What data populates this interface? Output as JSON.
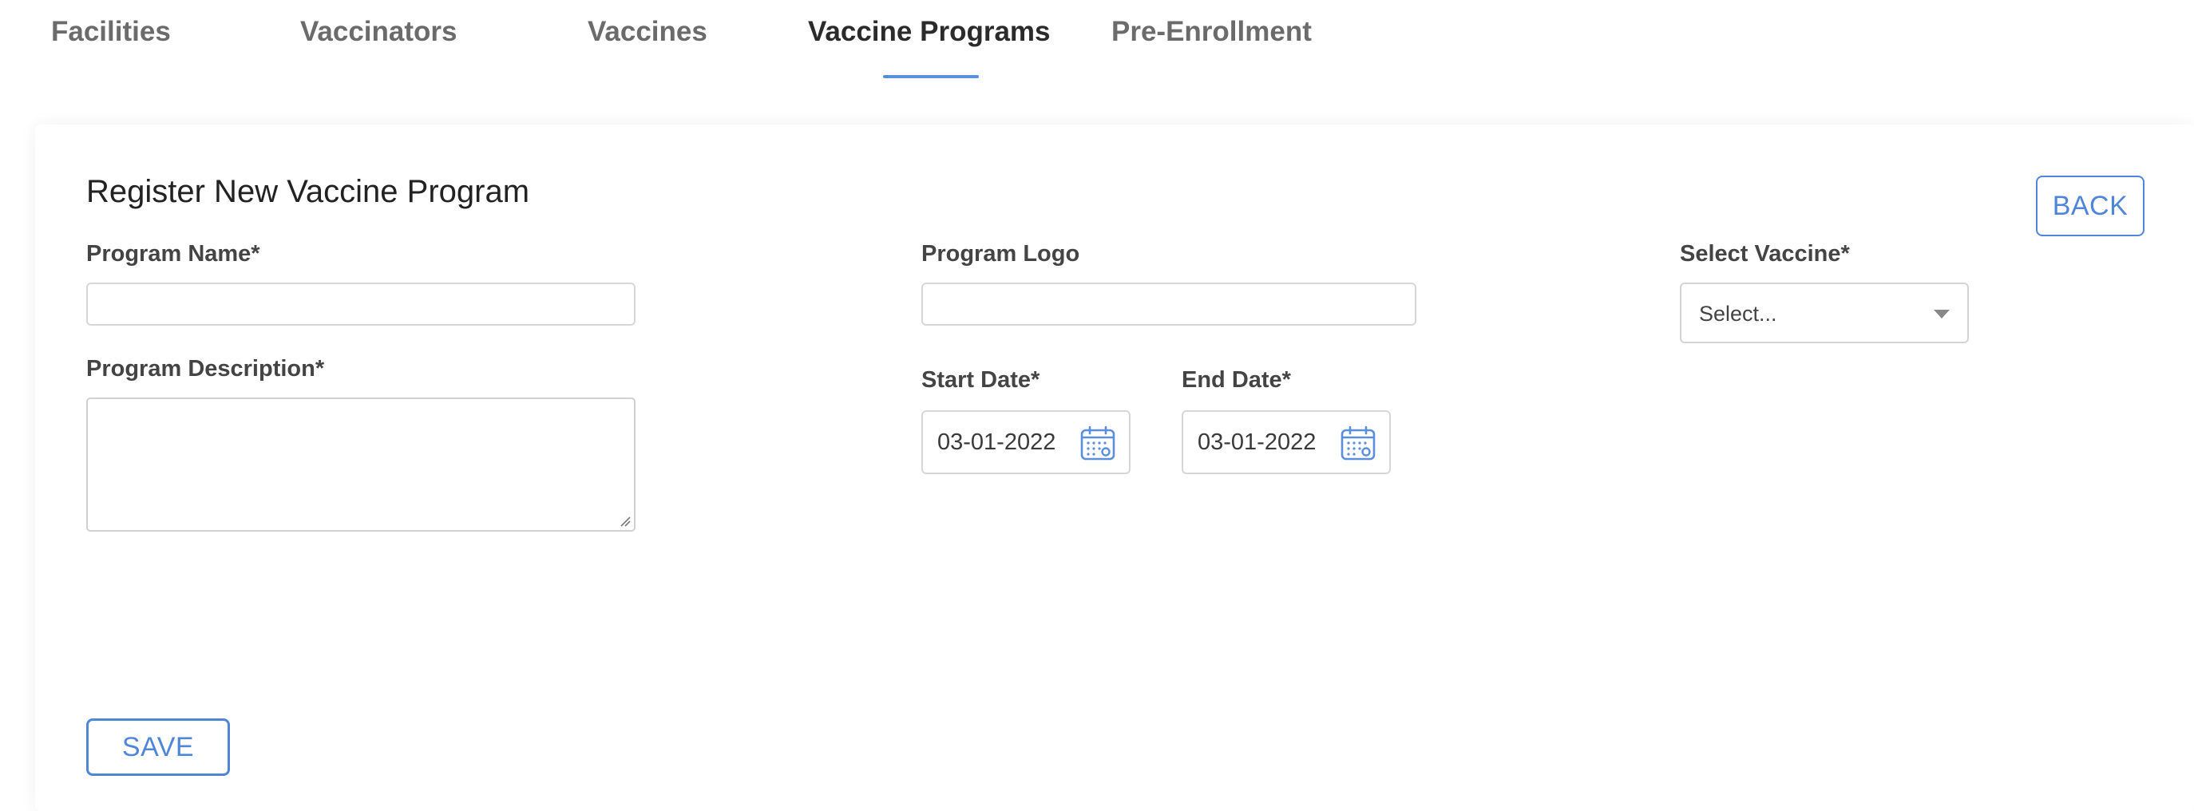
{
  "tabs": [
    {
      "label": "Facilities"
    },
    {
      "label": "Vaccinators"
    },
    {
      "label": "Vaccines"
    },
    {
      "label": "Vaccine Programs",
      "active": true
    },
    {
      "label": "Pre-Enrollment"
    }
  ],
  "form": {
    "title": "Register New Vaccine Program",
    "back_label": "BACK",
    "save_label": "SAVE",
    "program_name": {
      "label": "Program Name*",
      "value": ""
    },
    "program_description": {
      "label": "Program Description*",
      "value": ""
    },
    "program_logo": {
      "label": "Program Logo",
      "value": ""
    },
    "start_date": {
      "label": "Start Date*",
      "value": "03-01-2022",
      "icon": "calendar-icon"
    },
    "end_date": {
      "label": "End Date*",
      "value": "03-01-2022",
      "icon": "calendar-icon"
    },
    "select_vaccine": {
      "label": "Select Vaccine*",
      "value": "Select...",
      "icon": "chevron-down-icon"
    }
  },
  "colors": {
    "accent": "#4f86d8",
    "active_tab_underline": "#5b8fd9",
    "label_text": "#444444",
    "active_tab_text": "#2b2b2b",
    "inactive_tab_text": "#6b6b6b"
  }
}
